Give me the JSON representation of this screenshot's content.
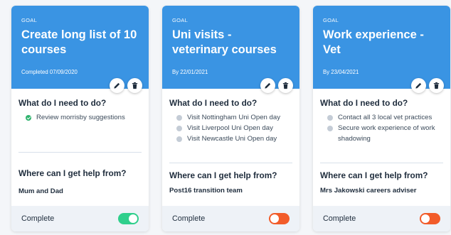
{
  "colors": {
    "header_blue": "#3a94e3",
    "toggle_on": "#2fcf8c",
    "toggle_off": "#f25c2a",
    "done_check": "#2fb36e"
  },
  "cards": [
    {
      "tag": "GOAL",
      "title": "Create long list of 10 courses",
      "date": "Completed 07/09/2020",
      "edit_icon": "pencil-icon",
      "delete_icon": "trash-icon",
      "need_title": "What do I need to do?",
      "needs": [
        {
          "text": "Review morrisby suggestions",
          "status": "done"
        }
      ],
      "help_title": "Where can I get help from?",
      "help_value": "Mum and Dad",
      "footer_label": "Complete",
      "complete": true
    },
    {
      "tag": "GOAL",
      "title": "Uni visits - veterinary courses",
      "date": "By 22/01/2021",
      "edit_icon": "pencil-icon",
      "delete_icon": "trash-icon",
      "need_title": "What do I need to do?",
      "needs": [
        {
          "text": "Visit Nottingham Uni Open day",
          "status": "pending"
        },
        {
          "text": "Visit Liverpool Uni Open day",
          "status": "pending"
        },
        {
          "text": "Visit Newcastle Uni Open day",
          "status": "pending"
        }
      ],
      "help_title": "Where can I get help from?",
      "help_value": "Post16 transition team",
      "footer_label": "Complete",
      "complete": false
    },
    {
      "tag": "GOAL",
      "title": "Work experience - Vet",
      "date": "By 23/04/2021",
      "edit_icon": "pencil-icon",
      "delete_icon": "trash-icon",
      "need_title": "What do I need to do?",
      "needs": [
        {
          "text": "Contact all 3 local vet practices",
          "status": "pending"
        },
        {
          "text": "Secure work experience of work shadowing",
          "status": "pending"
        }
      ],
      "help_title": "Where can I get help from?",
      "help_value": "Mrs Jakowski careers adviser",
      "footer_label": "Complete",
      "complete": false
    }
  ]
}
